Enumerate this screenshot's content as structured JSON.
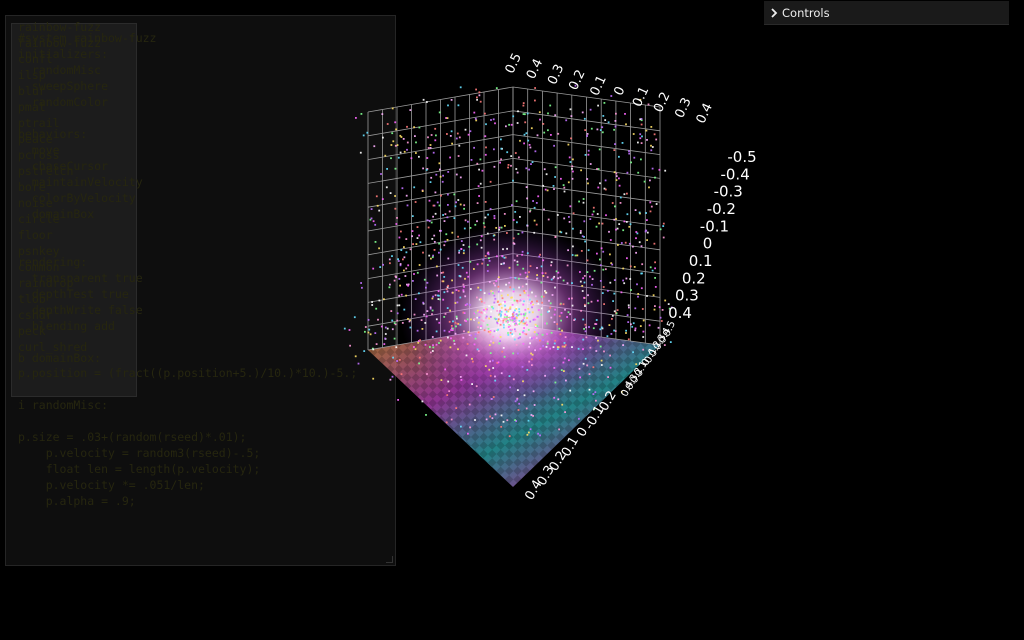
{
  "colors": {
    "background": "#000000",
    "grid": "#9a9a9a",
    "code_text": "#26260f",
    "controls_bg": "#1a1a1a"
  },
  "controls": {
    "label": "Controls",
    "icon": "chevron-right-icon"
  },
  "code_layer_a": [
    "rainbow-fuzz",
    "rainbow-fuzz",
    "confl",
    "ilsp",
    "blur",
    "pmat",
    "ptrail",
    "peace",
    "pcross",
    "pstretch",
    "bore",
    "noise",
    "circle",
    "floor",
    "psnkey",
    "common",
    "raindrop",
    "tlob",
    "cshdr",
    "peck",
    "curl_shred"
  ],
  "code_layer_b": [
    "#system rainbow-fuzz",
    "initializers:",
    "  randomMisc",
    "  sweepSphere",
    "  randomColor",
    "",
    "behaviors:",
    "  move",
    "  chaseCursor",
    "  maintainVelocity",
    "  colorByVelocity",
    "  domainBox",
    "",
    "",
    "rendering:",
    "  transparent true",
    "  depthTest true",
    "  depthWrite false",
    "  blending add",
    "",
    "b domainBox:"
  ],
  "code_layer_c": [
    "p.position = (fract((p.position+5.)/10.)*10.)-5.;",
    "",
    "i randomMisc:",
    "",
    "p.size = .03+(random(rseed)*.01);",
    "    p.velocity = random3(rseed)-.5;",
    "    float len = length(p.velocity);",
    "    p.velocity *= .051/len;",
    "    p.alpha = .9;"
  ],
  "axes": {
    "top": [
      "0.5",
      "0.4",
      "0.3",
      "0.2",
      "0.1",
      "0",
      "0.1",
      "0.2",
      "0.3",
      "0.4"
    ],
    "right": [
      "-0.5",
      "-0.4",
      "-0.3",
      "-0.2",
      "-0.1",
      "0",
      "0.1",
      "0.2",
      "0.3",
      "0.4"
    ],
    "lower_right": [
      "0.5",
      "0.4",
      "0.3",
      "0.2",
      "0.1",
      "0",
      "0.1",
      "0.2",
      "0.3",
      "0.4"
    ],
    "bottom": [
      "-0.2",
      "-0.1",
      "0",
      "0.1",
      "0.2",
      "0.3",
      "0.4"
    ]
  }
}
